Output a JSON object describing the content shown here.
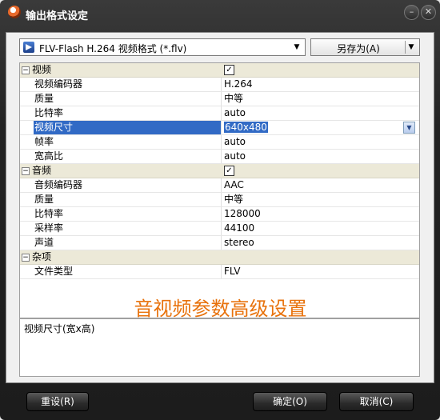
{
  "window": {
    "title": "输出格式设定"
  },
  "format_combo": {
    "value": "FLV-Flash H.264 视频格式 (*.flv)"
  },
  "save_as_label": "另存为(A)",
  "sections": [
    {
      "name": "视频",
      "checked": true,
      "rows": [
        {
          "name": "视频编码器",
          "value": "H.264"
        },
        {
          "name": "质量",
          "value": "中等"
        },
        {
          "name": "比特率",
          "value": "auto"
        },
        {
          "name": "视频尺寸",
          "value": "640x480",
          "selected": true
        },
        {
          "name": "帧率",
          "value": "auto"
        },
        {
          "name": "宽高比",
          "value": "auto"
        }
      ]
    },
    {
      "name": "音频",
      "checked": true,
      "rows": [
        {
          "name": "音频编码器",
          "value": "AAC"
        },
        {
          "name": "质量",
          "value": "中等"
        },
        {
          "name": "比特率",
          "value": "128000"
        },
        {
          "name": "采样率",
          "value": "44100"
        },
        {
          "name": "声道",
          "value": "stereo"
        }
      ]
    },
    {
      "name": "杂项",
      "checked": false,
      "rows": [
        {
          "name": "文件类型",
          "value": "FLV"
        }
      ]
    }
  ],
  "overlay_caption": "音视频参数高级设置",
  "description": "视频尺寸(宽x高)",
  "buttons": {
    "reset": "重设(R)",
    "ok": "确定(O)",
    "cancel": "取消(C)"
  },
  "colors": {
    "selection": "#316ac5",
    "caption": "#e8720c",
    "category_bg": "#ece9d8"
  }
}
